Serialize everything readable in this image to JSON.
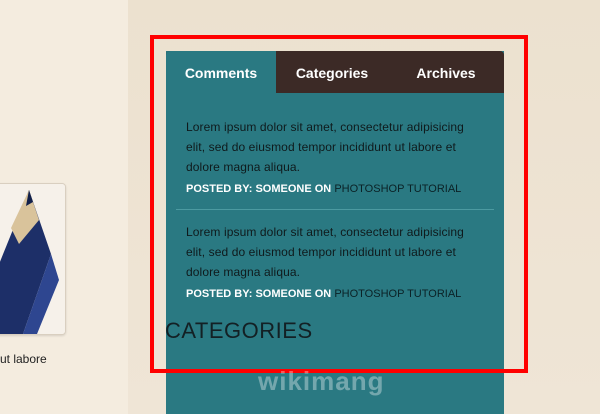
{
  "left_panel": {
    "snippet_text": "ut labore"
  },
  "widget": {
    "tabs": [
      {
        "label": "Comments"
      },
      {
        "label": "Categories"
      },
      {
        "label": "Archives"
      }
    ],
    "comments": [
      {
        "text": "Lorem ipsum dolor sit amet, consectetur adipisicing elit, sed do eiusmod tempor incididunt ut labore et dolore magna aliqua.",
        "posted_by": "POSTED BY: SOMEONE ON",
        "category": "PHOTOSHOP TUTORIAL"
      },
      {
        "text": "Lorem ipsum dolor sit amet, consectetur adipisicing elit, sed do eiusmod tempor incididunt ut labore et dolore magna aliqua.",
        "posted_by": "POSTED BY: SOMEONE ON",
        "category": "PHOTOSHOP TUTORIAL"
      }
    ],
    "section_heading": "CATEGORIES"
  },
  "watermark": "wikimang"
}
